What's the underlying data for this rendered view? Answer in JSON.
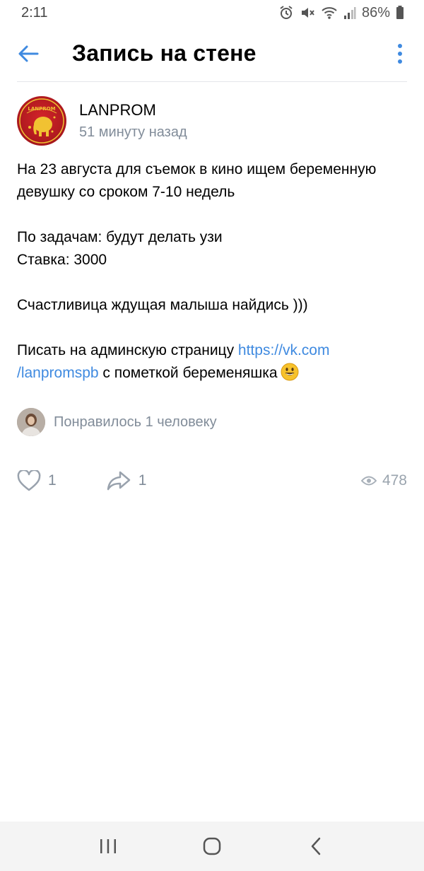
{
  "status_bar": {
    "time": "2:11",
    "battery": "86%",
    "icons": [
      "alarm-icon",
      "mute-icon",
      "wifi-icon",
      "signal-icon",
      "battery-icon"
    ]
  },
  "header": {
    "title": "Запись на стене",
    "back_icon": "arrow-left-icon",
    "menu_icon": "more-vertical-icon"
  },
  "post": {
    "author": "LANPROM",
    "avatar_text": "LANPROM",
    "time": "51 минуту назад",
    "paragraphs": {
      "p1_line1": "На 23 августа для съемок в кино ищем беременную",
      "p1_line2": "девушку со сроком 7-10 недель",
      "p2_line1": "По задачам: будут делать узи",
      "p2_line2": "Ставка: 3000",
      "p3": "Счастливица ждущая малыша найдись )))",
      "p4_prefix": "Писать на админскую страницу ",
      "p4_link_part1": "https://vk.com",
      "p4_link_part2": "/lanpromspb",
      "p4_suffix": " с пометкой беременяшка"
    },
    "emoji": "smiling-face-emoji"
  },
  "likes_summary": {
    "text": "Понравилось 1 человеку"
  },
  "actions": {
    "likes": "1",
    "shares": "1",
    "views": "478"
  },
  "colors": {
    "accent": "#3f8ae0",
    "secondary_text": "#818c99",
    "avatar_red": "#c21f25",
    "nav_bg": "#f4f4f4"
  }
}
